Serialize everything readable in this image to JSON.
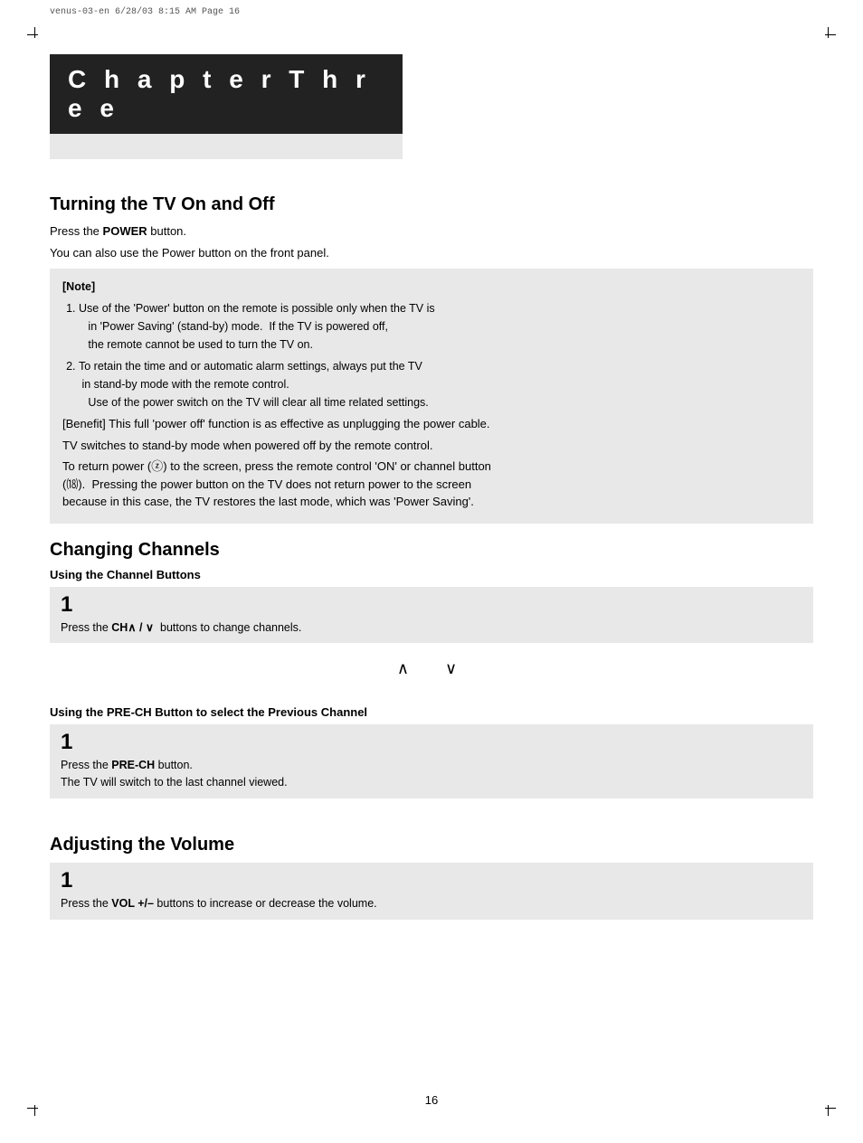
{
  "file_info": "venus-03-en  6/28/03 8:15 AM   Page 16",
  "chapter": {
    "title": "C h a p t e r   T h r e e"
  },
  "sections": {
    "turning_tv": {
      "title": "Turning the TV On and Off",
      "intro1": "Press the POWER button.",
      "intro2": "You can also use the Power button on the front panel.",
      "note_label": "[Note]",
      "note_items": [
        "Use of the 'Power' button on the remote is possible only when the TV is in 'Power Saving' (stand-by) mode.  If the TV is powered off, the remote cannot be used to turn the TV on.",
        "To retain the time and or automatic alarm settings, always put the TV in stand-by mode with the remote control. Use of the power switch on the TV will clear all time related settings."
      ],
      "benefit": "[Benefit] This full 'power off' function is as effective as unplugging the power cable.",
      "line1": "TV switches to stand-by mode when powered off by the remote control.",
      "line2": "To return power (ⓩ) to the screen, press the remote control 'ON' or channel button (⒅).  Pressing the power button on the TV does not return power to the screen because in this case, the TV restores the last mode, which was 'Power Saving'."
    },
    "changing_channels": {
      "title": "Changing Channels",
      "sub1": {
        "label": "Using the Channel Buttons",
        "step_num": "1",
        "step_text": "Press the CH∧ / ∨  buttons to change channels."
      },
      "arrows": "∧  ∨",
      "sub2": {
        "label": "Using the PRE-CH Button to select the Previous Channel",
        "step_num": "1",
        "step_line1": "Press the PRE-CH button.",
        "step_line2": "The TV will switch to the last channel viewed."
      }
    },
    "adjusting_volume": {
      "title": "Adjusting the Volume",
      "step_num": "1",
      "step_text": "Press the VOL +/– buttons to increase or decrease the volume."
    }
  },
  "page_number": "16"
}
